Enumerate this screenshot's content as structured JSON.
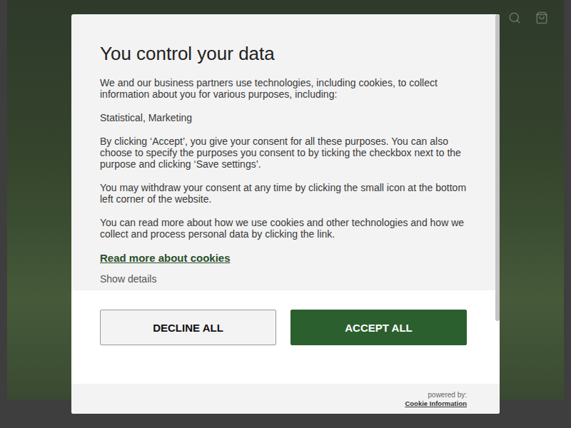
{
  "dialog": {
    "title": "You control your data",
    "paragraphs": [
      "We and our business partners use technologies, including cookies, to collect information about you for various purposes, including:",
      "Statistical, Marketing",
      "By clicking ‘Accept’, you give your consent for all these purposes. You can also choose to specify the purposes you consent to by ticking the checkbox next to the purpose and clicking ‘Save settings’.",
      "You may withdraw your consent at any time by clicking the small icon at the bottom left corner of the website.",
      "You can read more about how we use cookies and other technologies and how we collect and process personal data by clicking the link."
    ],
    "link": "Read more about cookies",
    "details": "Show details",
    "buttons": [
      {
        "label": "DECLINE ALL",
        "kind": "secondary"
      },
      {
        "label": "ACCEPT ALL",
        "kind": "primary"
      }
    ],
    "footer": {
      "powered": "powered by:",
      "brand": "Cookie Information"
    }
  }
}
